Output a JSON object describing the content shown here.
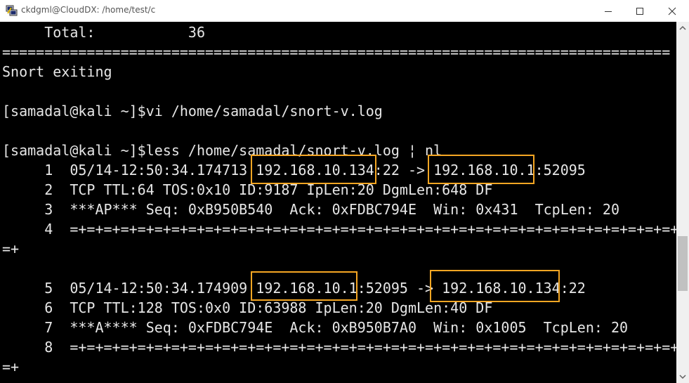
{
  "window": {
    "title": "ckdgml@CloudDX: /home/test/c",
    "accent_color": "#f5a623"
  },
  "terminal": {
    "lines": [
      "     Total:           36",
      "===============================================================================",
      "Snort exiting",
      "",
      "[samadal@kali ~]$vi /home/samadal/snort-v.log",
      "",
      "[samadal@kali ~]$less /home/samadal/snort-v.log ¦ nl",
      "     1  05/14-12:50:34.174713 192.168.10.134:22 -> 192.168.10.1:52095",
      "     2  TCP TTL:64 TOS:0x10 ID:9187 IpLen:20 DgmLen:648 DF",
      "     3  ***AP*** Seq: 0xB950B540  Ack: 0xFDBC794E  Win: 0x431  TcpLen: 20",
      "     4  =+=+=+=+=+=+=+=+=+=+=+=+=+=+=+=+=+=+=+=+=+=+=+=+=+=+=+=+=+=+=+=+=+=+=+=+=+",
      "=+",
      "",
      "     5  05/14-12:50:34.174909 192.168.10.1:52095 -> 192.168.10.134:22",
      "     6  TCP TTL:128 TOS:0x0 ID:63988 IpLen:20 DgmLen:40 DF",
      "     7  ***A**** Seq: 0xFDBC794E  Ack: 0xB950B7A0  Win: 0x1005  TcpLen: 20",
      "     8  =+=+=+=+=+=+=+=+=+=+=+=+=+=+=+=+=+=+=+=+=+=+=+=+=+=+=+=+=+=+=+=+=+=+=+=+=+",
      "=+"
    ],
    "text_color": "#e6e6e6",
    "background_color": "#000000"
  }
}
